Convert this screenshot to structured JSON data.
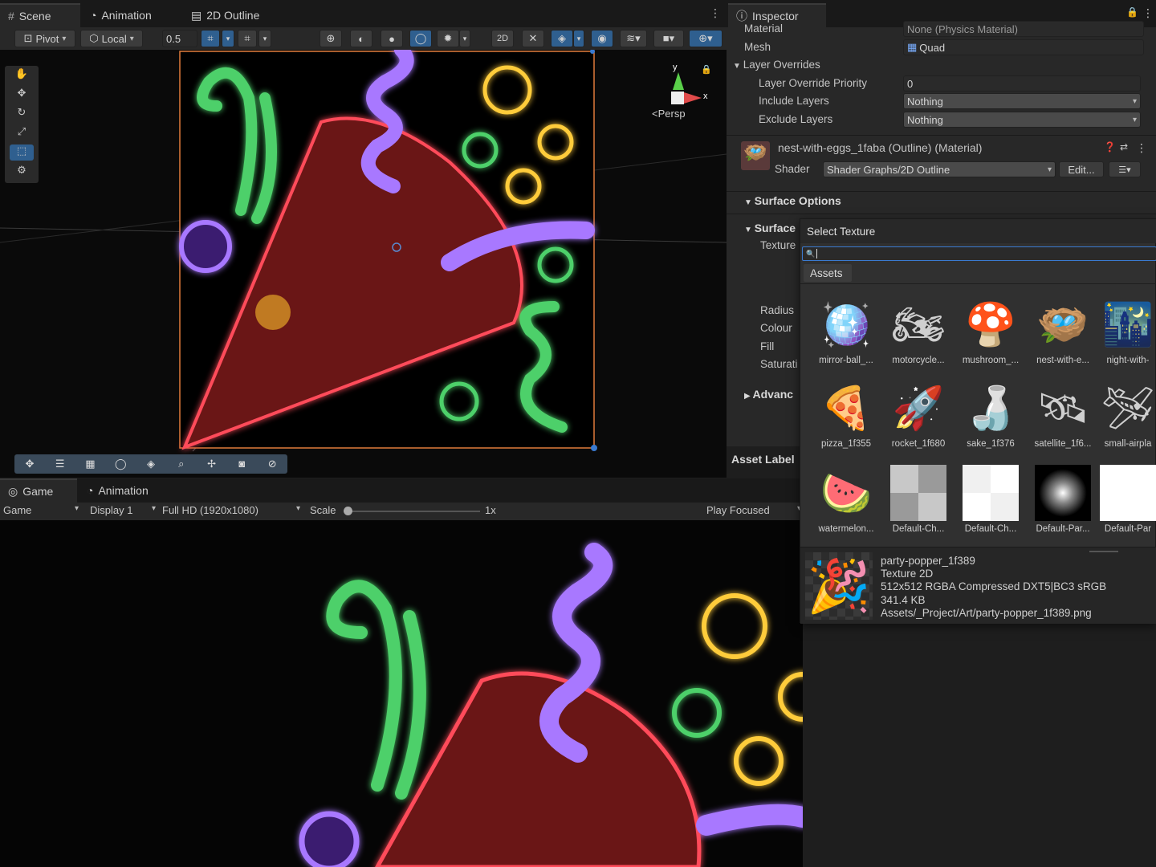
{
  "scene": {
    "tabs": [
      {
        "label": "Scene"
      },
      {
        "label": "Animation"
      },
      {
        "label": "2D Outline"
      }
    ],
    "pivot": "Pivot",
    "local": "Local",
    "snap_value": "0.5",
    "gizmo": {
      "y": "y",
      "x": "x",
      "persp": "Persp"
    }
  },
  "game": {
    "tabs": [
      {
        "label": "Game"
      },
      {
        "label": "Animation"
      }
    ],
    "mode": "Game",
    "display": "Display 1",
    "resolution": "Full HD (1920x1080)",
    "scale_label": "Scale",
    "scale_value": "1x",
    "play_mode": "Play Focused"
  },
  "inspector": {
    "title": "Inspector",
    "material_label": "Material",
    "material_value": "None (Physics Material)",
    "mesh_label": "Mesh",
    "mesh_value": "Quad",
    "layer_overrides": "Layer Overrides",
    "layer_override_priority_label": "Layer Override Priority",
    "layer_override_priority_value": "0",
    "include_layers_label": "Include Layers",
    "include_layers_value": "Nothing",
    "exclude_layers_label": "Exclude Layers",
    "exclude_layers_value": "Nothing",
    "material_name": "nest-with-eggs_1faba (Outline) (Material)",
    "shader_label": "Shader",
    "shader_value": "Shader Graphs/2D Outline",
    "edit_button": "Edit...",
    "surface_options": "Surface Options",
    "surface_partial": "Surface",
    "texture_partial": "Texture",
    "radius": "Radius",
    "colour": "Colour",
    "fill": "Fill",
    "saturation_partial": "Saturati",
    "advanced_partial": "Advanc",
    "asset_label": "Asset Label"
  },
  "select_texture": {
    "title": "Select Texture",
    "search_placeholder": "",
    "tab": "Assets",
    "assets": [
      {
        "name": "mirror-ball_...",
        "icon": "🪩"
      },
      {
        "name": "motorcycle...",
        "icon": "🏍"
      },
      {
        "name": "mushroom_...",
        "icon": "🍄"
      },
      {
        "name": "nest-with-e...",
        "icon": "🪺"
      },
      {
        "name": "night-with-",
        "icon": "🌃"
      },
      {
        "name": "pizza_1f355",
        "icon": "🍕"
      },
      {
        "name": "rocket_1f680",
        "icon": "🚀"
      },
      {
        "name": "sake_1f376",
        "icon": "🍶"
      },
      {
        "name": "satellite_1f6...",
        "icon": "🛰"
      },
      {
        "name": "small-airpla",
        "icon": "🛩"
      },
      {
        "name": "watermelon...",
        "icon": "🍉"
      },
      {
        "name": "Default-Ch...",
        "icon": "checker-gray"
      },
      {
        "name": "Default-Ch...",
        "icon": "checker-white"
      },
      {
        "name": "Default-Par...",
        "icon": "particle-glow"
      },
      {
        "name": "Default-Par",
        "icon": "white-square"
      }
    ],
    "preview": {
      "name": "party-popper_1f389",
      "type": "Texture 2D",
      "format": "512x512  RGBA Compressed DXT5|BC3 sRGB",
      "size": "341.4 KB",
      "path": "Assets/_Project/Art/party-popper_1f389.png"
    }
  }
}
